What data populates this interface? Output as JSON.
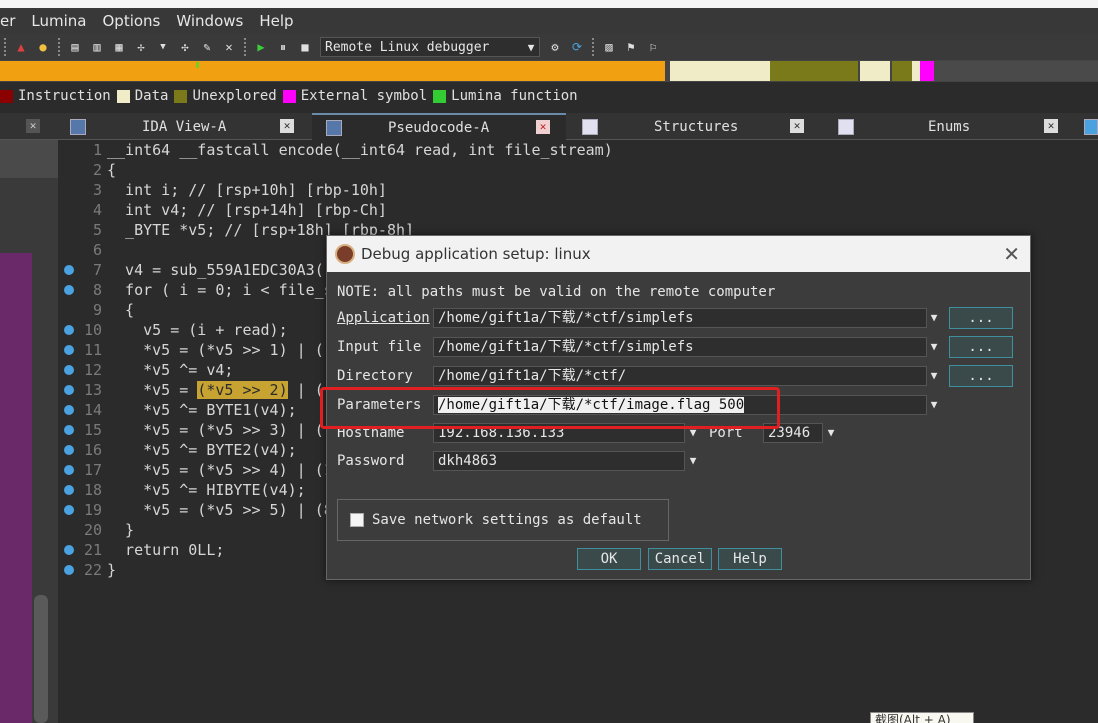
{
  "menu": [
    "er",
    "Lumina",
    "Options",
    "Windows",
    "Help"
  ],
  "toolbar": {
    "debugger": "Remote Linux debugger"
  },
  "legend": [
    {
      "label": "Instruction",
      "color": "#8b0000"
    },
    {
      "label": "Data",
      "color": "#f0ecc8"
    },
    {
      "label": "Unexplored",
      "color": "#7a7a1a"
    },
    {
      "label": "External symbol",
      "color": "#ff00ff"
    },
    {
      "label": "Lumina function",
      "color": "#33cc33"
    }
  ],
  "tabs": [
    {
      "label": "IDA View-A"
    },
    {
      "label": "Pseudocode-A"
    },
    {
      "label": "Structures"
    },
    {
      "label": "Enums"
    }
  ],
  "code": {
    "lines": [
      {
        "n": "1",
        "t": "__int64 __fastcall encode(__int64 read, int file_stream)"
      },
      {
        "n": "2",
        "t": "{"
      },
      {
        "n": "3",
        "t": "  int i; // [rsp+10h] [rbp-10h]"
      },
      {
        "n": "4",
        "t": "  int v4; // [rsp+14h] [rbp-Ch]"
      },
      {
        "n": "5",
        "t": "  _BYTE *v5; // [rsp+18h] [rbp-8h]"
      },
      {
        "n": "6",
        "t": ""
      },
      {
        "n": "7",
        "t": "  v4 = sub_559A1EDC30A3("
      },
      {
        "n": "8",
        "t": "  for ( i = 0; i < file_s"
      },
      {
        "n": "9",
        "t": "  {"
      },
      {
        "n": "10",
        "t": "    v5 = (i + read);"
      },
      {
        "n": "11",
        "t": "    *v5 = (*v5 >> 1) | ("
      },
      {
        "n": "12",
        "t": "    *v5 ^= v4;"
      },
      {
        "n": "13",
        "pre": "    *v5 = ",
        "hl": "(*v5 >> 2)",
        "post": " | ("
      },
      {
        "n": "14",
        "t": "    *v5 ^= BYTE1(v4);"
      },
      {
        "n": "15",
        "t": "    *v5 = (*v5 >> 3) | ("
      },
      {
        "n": "16",
        "t": "    *v5 ^= BYTE2(v4);"
      },
      {
        "n": "17",
        "t": "    *v5 = (*v5 >> 4) | (1"
      },
      {
        "n": "18",
        "t": "    *v5 ^= HIBYTE(v4);"
      },
      {
        "n": "19",
        "t": "    *v5 = (*v5 >> 5) | (8"
      },
      {
        "n": "20",
        "t": "  }"
      },
      {
        "n": "21",
        "t": "  return 0LL;"
      },
      {
        "n": "22",
        "t": "}"
      }
    ]
  },
  "dialog": {
    "title": "Debug application setup: linux",
    "note": "NOTE: all paths must be valid on the remote computer",
    "application_label": "Application",
    "application_value": "/home/gift1a/下载/*ctf/simplefs",
    "input_label": "Input file",
    "input_value": "/home/gift1a/下载/*ctf/simplefs",
    "directory_label": "Directory",
    "directory_value": "/home/gift1a/下载/*ctf/",
    "parameters_label": "Parameters",
    "parameters_value": "/home/gift1a/下载/*ctf/image.flag 500",
    "hostname_label": "Hostname",
    "hostname_value": "192.168.136.133",
    "port_label": "Port",
    "port_value": "23946",
    "password_label": "Password",
    "password_value": "dkh4863",
    "browse_label": "...",
    "save_label": "Save network settings as default",
    "ok": "OK",
    "cancel": "Cancel",
    "help": "Help"
  },
  "tooltip": "截图(Alt + A)"
}
